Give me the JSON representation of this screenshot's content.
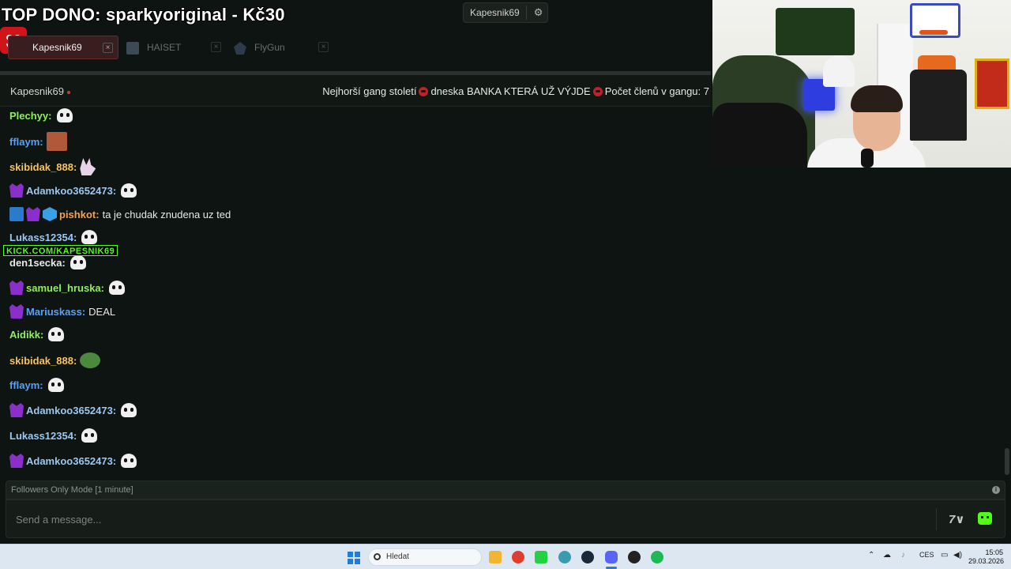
{
  "overlay": {
    "top_dono": "TOP DONO: sparkyoriginal - Kč30",
    "watermark": "KICK.COM/KAPESNIK69"
  },
  "user_menu": {
    "username": "Kapesnik69"
  },
  "tabs": [
    {
      "label": "Kapesnik69",
      "active": true
    },
    {
      "label": "HAISET",
      "active": false
    },
    {
      "label": "FlyGun",
      "active": false
    }
  ],
  "channel": {
    "name": "Kapesnik69",
    "title_part1": "Nejhorší gang století",
    "title_part2": "dneska BANKA KTERÁ UŽ VÝJDE",
    "title_part3": "Počet členů v gangu: 7"
  },
  "chat": [
    {
      "user": "Plechyy",
      "color": "#8ef05a",
      "badges": [],
      "text": "",
      "emote": "skull"
    },
    {
      "user": "fflaym",
      "color": "#5aa0f5",
      "badges": [],
      "text": "",
      "emote": "pic"
    },
    {
      "user": "skibidak_888",
      "color": "#f7c35a",
      "badges": [],
      "text": "",
      "emote": "bunny"
    },
    {
      "user": "Adamkoo3652473",
      "color": "#9ac8f2",
      "badges": [
        "sub"
      ],
      "text": "",
      "emote": "skull"
    },
    {
      "user": "pishkot",
      "color": "#f5a04b",
      "badges": [
        "mod",
        "sub",
        "cube"
      ],
      "text": "ta je chudak znudena uz ted",
      "emote": ""
    },
    {
      "user": "Lukass12354",
      "color": "#9ac8f2",
      "badges": [],
      "text": "",
      "emote": "skull"
    },
    {
      "user": "den1secka",
      "color": "#e8e8e8",
      "badges": [],
      "text": "",
      "emote": "skull"
    },
    {
      "user": "samuel_hruska",
      "color": "#8ef05a",
      "badges": [
        "sub"
      ],
      "text": "",
      "emote": "skull"
    },
    {
      "user": "Mariuskass",
      "color": "#5aa0f5",
      "badges": [
        "sub"
      ],
      "text": "DEAL",
      "emote": ""
    },
    {
      "user": "Aidikk",
      "color": "#8ef05a",
      "badges": [],
      "text": "",
      "emote": "skull"
    },
    {
      "user": "skibidak_888",
      "color": "#f7c35a",
      "badges": [],
      "text": "",
      "emote": "pepe"
    },
    {
      "user": "fflaym",
      "color": "#5aa0f5",
      "badges": [],
      "text": "",
      "emote": "skull"
    },
    {
      "user": "Adamkoo3652473",
      "color": "#9ac8f2",
      "badges": [
        "sub"
      ],
      "text": "",
      "emote": "skull"
    },
    {
      "user": "Lukass12354",
      "color": "#9ac8f2",
      "badges": [],
      "text": "",
      "emote": "skull"
    },
    {
      "user": "Adamkoo3652473",
      "color": "#9ac8f2",
      "badges": [
        "sub"
      ],
      "text": "",
      "emote": "skull"
    }
  ],
  "chat_mode": "Followers Only Mode [1 minute]",
  "composer": {
    "placeholder": "Send a message..."
  },
  "taskbar": {
    "search_label": "Hledat",
    "lang": "CES",
    "time": "15:05",
    "date": "29.03.2026"
  }
}
